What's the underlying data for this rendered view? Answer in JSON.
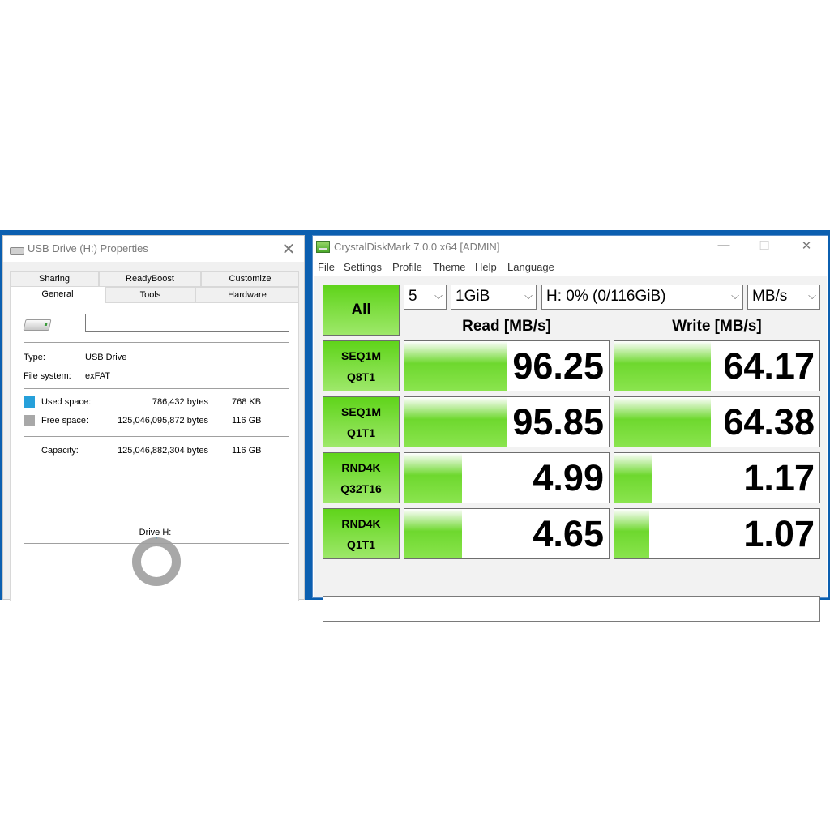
{
  "props": {
    "title": "USB Drive (H:) Properties",
    "close_glyph": "✕",
    "tabs_row1": [
      "Sharing",
      "ReadyBoost",
      "Customize"
    ],
    "tabs_row2": [
      "General",
      "Tools",
      "Hardware"
    ],
    "name_value": "",
    "type_label": "Type:",
    "type_value": "USB Drive",
    "fs_label": "File system:",
    "fs_value": "exFAT",
    "used_label": "Used space:",
    "used_bytes": "786,432 bytes",
    "used_size": "768 KB",
    "free_label": "Free space:",
    "free_bytes": "125,046,095,872 bytes",
    "free_size": "116 GB",
    "cap_label": "Capacity:",
    "cap_bytes": "125,046,882,304 bytes",
    "cap_size": "116 GB",
    "drive_label": "Drive H:",
    "used_fraction": 6.3e-06,
    "colors": {
      "used": "#26a0da",
      "free": "#a8a8a8"
    }
  },
  "cdm": {
    "title": "CrystalDiskMark 7.0.0 x64 [ADMIN]",
    "win_min": "—",
    "win_max": "☐",
    "win_close": "✕",
    "menu": [
      "File",
      "Settings",
      "Profile",
      "Theme",
      "Help",
      "Language"
    ],
    "all_label": "All",
    "count": "5",
    "size": "1GiB",
    "drive": "H: 0% (0/116GiB)",
    "unit": "MB/s",
    "read_header": "Read [MB/s]",
    "write_header": "Write [MB/s]",
    "rows": [
      {
        "l1": "SEQ1M",
        "l2": "Q8T1",
        "read": "96.25",
        "write": "64.17",
        "read_bar": 0.5,
        "write_bar": 0.47
      },
      {
        "l1": "SEQ1M",
        "l2": "Q1T1",
        "read": "95.85",
        "write": "64.38",
        "read_bar": 0.5,
        "write_bar": 0.47
      },
      {
        "l1": "RND4K",
        "l2": "Q32T16",
        "read": "4.99",
        "write": "1.17",
        "read_bar": 0.28,
        "write_bar": 0.18
      },
      {
        "l1": "RND4K",
        "l2": "Q1T1",
        "read": "4.65",
        "write": "1.07",
        "read_bar": 0.28,
        "write_bar": 0.17
      }
    ],
    "comment": ""
  }
}
